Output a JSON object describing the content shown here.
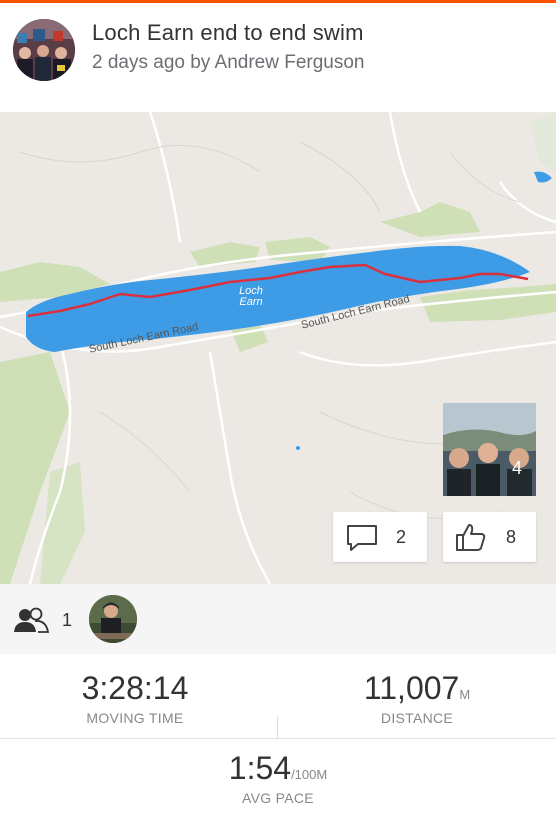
{
  "activity": {
    "title": "Loch Earn end to end swim",
    "subtitle": "2 days ago by Andrew Ferguson"
  },
  "map": {
    "loch_label": "Loch\nEarn",
    "road_label_left": "South Loch Earn Road",
    "road_label_right": "South Loch Earn Road",
    "photo_count": "4",
    "water_color": "#3e9ce6",
    "route_color": "#d9313d"
  },
  "actions": {
    "comments_count": "2",
    "kudos_count": "8"
  },
  "athletes": {
    "count": "1"
  },
  "stats": {
    "moving_time": {
      "value": "3:28:14",
      "label": "MOVING TIME"
    },
    "distance": {
      "value": "11,007",
      "unit": "M",
      "label": "DISTANCE"
    },
    "avg_pace": {
      "value": "1:54",
      "unit": "/100M",
      "label": "AVG PACE"
    }
  },
  "colors": {
    "brand": "#fc5200",
    "text_primary": "#333333",
    "text_secondary": "#888888"
  },
  "icons": [
    "comment-icon",
    "thumbs-up-icon",
    "group-icon"
  ]
}
